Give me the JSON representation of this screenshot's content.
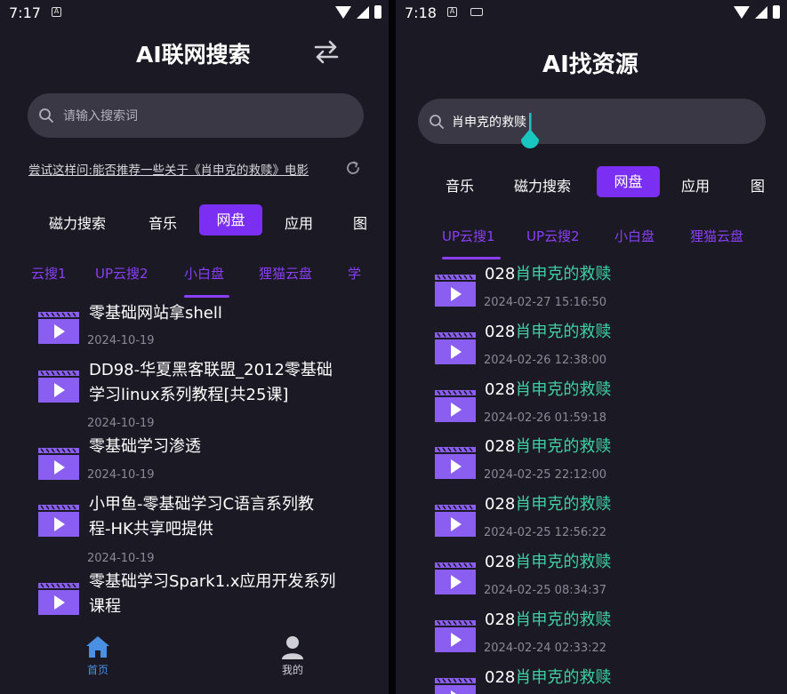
{
  "left": {
    "status_time": "7:17",
    "title": "AI联网搜索",
    "search_placeholder": "请输入搜索词",
    "suggestion": "尝试这样问:能否推荐一些关于《肖申克的救赎》电影",
    "categories": [
      "磁力搜索",
      "音乐",
      "网盘",
      "应用",
      "图"
    ],
    "active_category": "网盘",
    "sub_tabs": [
      "云搜1",
      "UP云搜2",
      "小白盘",
      "狸猫云盘",
      "学"
    ],
    "active_sub_tab": "小白盘",
    "results": [
      {
        "line1": "零基础网站拿shell",
        "line2": "",
        "date": "2024-10-19"
      },
      {
        "line1": "DD98-华夏黑客联盟_2012零基础",
        "line2": "学习linux系列教程[共25课]",
        "date": "2024-10-19"
      },
      {
        "line1": "零基础学习渗透",
        "line2": "",
        "date": "2024-10-19"
      },
      {
        "line1": "小甲鱼-零基础学习C语言系列教",
        "line2": "程-HK共享吧提供",
        "date": "2024-10-19"
      },
      {
        "line1": "零基础学习Spark1.x应用开发系列",
        "line2": "课程",
        "date": ""
      }
    ],
    "nav": {
      "home": "首页",
      "mine": "我的"
    }
  },
  "right": {
    "status_time": "7:18",
    "title": "AI找资源",
    "search_value": "肖申克的救赎",
    "categories": [
      "音乐",
      "磁力搜索",
      "网盘",
      "应用",
      "图"
    ],
    "active_category": "网盘",
    "sub_tabs": [
      "UP云搜1",
      "UP云搜2",
      "小白盘",
      "狸猫云盘"
    ],
    "active_sub_tab": "UP云搜1",
    "results": [
      {
        "prefix": "028",
        "name": "肖申克的救赎",
        "date": "2024-02-27 15:16:50"
      },
      {
        "prefix": "028",
        "name": "肖申克的救赎",
        "date": "2024-02-26 12:38:00"
      },
      {
        "prefix": "028",
        "name": "肖申克的救赎",
        "date": "2024-02-26 01:59:18"
      },
      {
        "prefix": "028",
        "name": "肖申克的救赎",
        "date": "2024-02-25 22:12:00"
      },
      {
        "prefix": "028",
        "name": "肖申克的救赎",
        "date": "2024-02-25 12:56:22"
      },
      {
        "prefix": "028",
        "name": "肖申克的救赎",
        "date": "2024-02-25 08:34:37"
      },
      {
        "prefix": "028",
        "name": "肖申克的救赎",
        "date": "2024-02-24 02:33:22"
      },
      {
        "prefix": "028",
        "name": "肖申克的救赎",
        "date": ""
      }
    ]
  },
  "colors": {
    "accent": "#7b2ff2",
    "highlight": "#3fd0a6",
    "background": "#1b1923",
    "nav_active": "#4a90e2"
  },
  "icons": [
    "search-icon",
    "swap-icon",
    "refresh-icon",
    "video-file-icon",
    "home-icon",
    "user-icon",
    "wifi-icon",
    "signal-icon",
    "battery-icon",
    "keyboard-icon"
  ]
}
